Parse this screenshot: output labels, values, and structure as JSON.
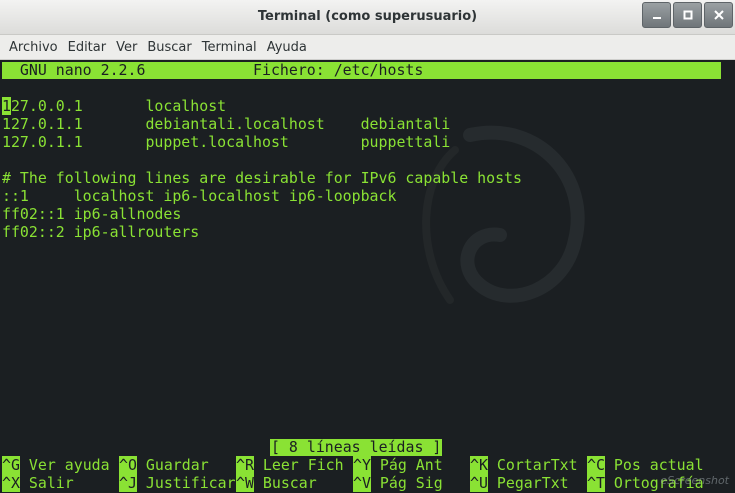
{
  "window": {
    "title": "Terminal (como superusuario)",
    "buttons": [
      "minimize-icon",
      "maximize-icon",
      "close-icon"
    ]
  },
  "menubar": [
    "Archivo",
    "Editar",
    "Ver",
    "Buscar",
    "Terminal",
    "Ayuda"
  ],
  "nano": {
    "header": "  GNU nano 2.2.6            Fichero: /etc/hosts",
    "cursor_char": "1",
    "lines": [
      "27.0.0.1       localhost",
      "127.0.1.1       debiantali.localhost    debiantali",
      "127.0.1.1       puppet.localhost        puppettali",
      "",
      "# The following lines are desirable for IPv6 capable hosts",
      "::1     localhost ip6-localhost ip6-loopback",
      "ff02::1 ip6-allnodes",
      "ff02::2 ip6-allrouters"
    ],
    "status": "[ 8 líneas leídas ]",
    "shortcuts_row1": [
      {
        "key": "^G",
        "label": " Ver ayuda"
      },
      {
        "key": "^O",
        "label": " Guardar"
      },
      {
        "key": "^R",
        "label": " Leer Fich"
      },
      {
        "key": "^Y",
        "label": " Pág Ant"
      },
      {
        "key": "^K",
        "label": " CortarTxt"
      },
      {
        "key": "^C",
        "label": " Pos actual"
      }
    ],
    "shortcuts_row2": [
      {
        "key": "^X",
        "label": " Salir"
      },
      {
        "key": "^J",
        "label": " Justificar"
      },
      {
        "key": "^W",
        "label": " Buscar"
      },
      {
        "key": "^V",
        "label": " Pág Sig"
      },
      {
        "key": "^U",
        "label": " PegarTxt"
      },
      {
        "key": "^T",
        "label": " Ortografía"
      }
    ]
  },
  "watermark": "eScreenshot",
  "colors": {
    "terminal_bg": "#1b1f22",
    "terminal_fg": "#8ae234"
  }
}
